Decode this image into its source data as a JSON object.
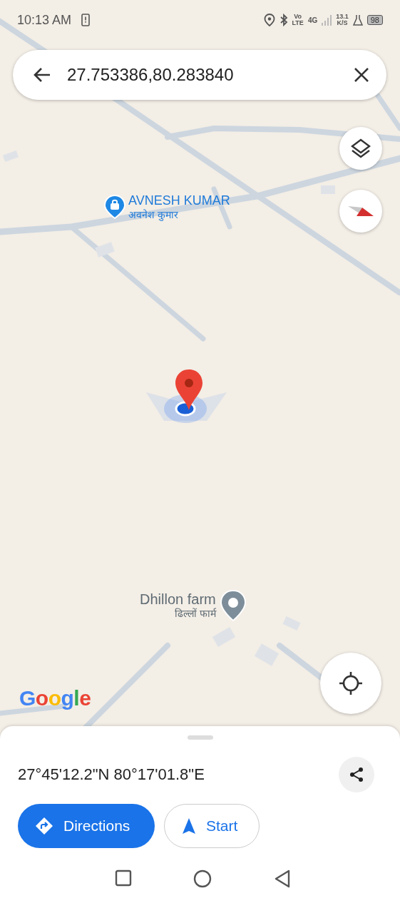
{
  "status_bar": {
    "time": "10:13 AM",
    "volte_top": "Vo",
    "volte_bottom": "LTE",
    "network": "4G",
    "speed": "13.1",
    "speed_unit": "K/S",
    "battery": "98"
  },
  "search": {
    "value": "27.753386,80.283840"
  },
  "map": {
    "places": [
      {
        "kind": "shop",
        "name": "AVNESH KUMAR",
        "local_name": "अवनेश कुमार"
      },
      {
        "kind": "farm",
        "name": "Dhillon farm",
        "local_name": "ढिल्लों फार्म"
      }
    ],
    "logo": "Google"
  },
  "sheet": {
    "coordinates": "27°45'12.2\"N 80°17'01.8\"E",
    "buttons": [
      {
        "kind": "directions",
        "label": "Directions"
      },
      {
        "kind": "start",
        "label": "Start"
      }
    ]
  }
}
